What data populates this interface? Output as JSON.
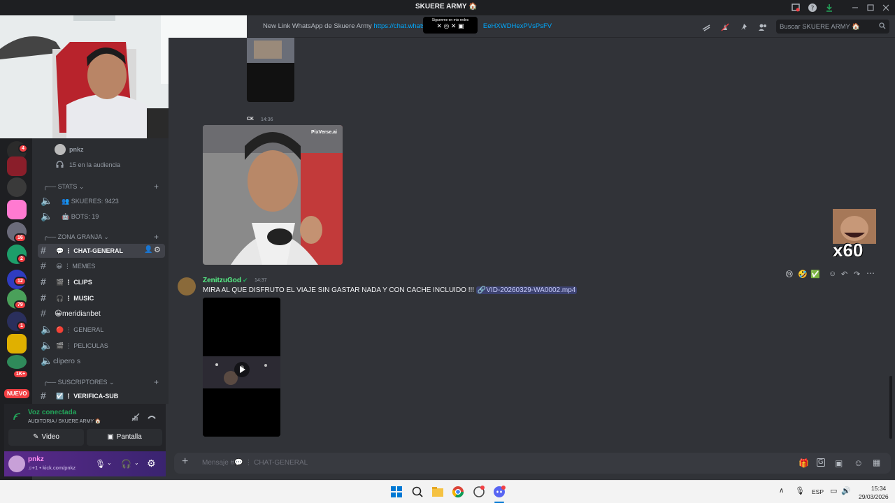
{
  "window": {
    "title": "SKUERE ARMY 🏠"
  },
  "header": {
    "topic_prefix": "New Link WhatsApp de Skuere Army",
    "topic_link": "https://chat.whatsap",
    "topic_link_tail": "EeHXWDHexPVsPsFV",
    "overlay_text": "Siguenme en mis redes",
    "search_placeholder": "Buscar SKUERE ARMY 🏠"
  },
  "rail": {
    "badges": [
      "4",
      "16",
      "2",
      "12",
      "79",
      "1",
      "1K+"
    ],
    "nuevo_label": "NUEVO"
  },
  "sidebar": {
    "stage_user": "pnkz",
    "stage_audience": "15 en la audiencia",
    "categories": [
      {
        "name": "STATS"
      },
      {
        "name": "ZONA GRANJA"
      },
      {
        "name": "SUSCRIPTORES"
      }
    ],
    "channels": [
      {
        "label": "👥 SKUERES: 9423"
      },
      {
        "label": "🤖 BOTS: 19"
      },
      {
        "label": "💬 ⋮ CHAT-GENERAL"
      },
      {
        "label": "😀 ⋮ MEMES"
      },
      {
        "label": "🎬 ⋮ CLIPS"
      },
      {
        "label": "🎧 ⋮ MUSIC"
      },
      {
        "label": "😀meridianbet"
      },
      {
        "label": "🔴 ⋮ GENERAL"
      },
      {
        "label": "🎬 ⋮ PELICULAS"
      },
      {
        "label": "clipero s"
      },
      {
        "label": "☑️ ⋮ VERIFICA-SUB"
      }
    ]
  },
  "voice": {
    "status": "Voz conectada",
    "location": "AUDITORIA / SKUERE ARMY 🏠",
    "video_label": "Video",
    "screen_label": "Pantalla"
  },
  "user": {
    "name": "pnkz",
    "status": "♫+1 • kick.com/pnkz"
  },
  "messages": [
    {
      "author_partial": "CK",
      "time": "14:36",
      "image_caption": "PixVerse.ai"
    },
    {
      "author": "ZenitzuGod",
      "time": "14:37",
      "text": "MIRA AL QUE DISFRUTO EL VIAJE SIN GASTAR NADA Y CON CACHE INCLUIDO !!!",
      "attachment": "VID-20260329-WA0002.mp4"
    }
  ],
  "emote": {
    "label": "x60"
  },
  "composer": {
    "placeholder": "Mensaje #💬 ⋮ CHAT-GENERAL"
  },
  "taskbar": {
    "lang": "ESP",
    "time": "15:34",
    "date": "29/03/2026"
  },
  "colors": {
    "accent": "#5865f2",
    "online": "#23a55a",
    "link": "#00a8fc",
    "mention": "#f23f43"
  }
}
